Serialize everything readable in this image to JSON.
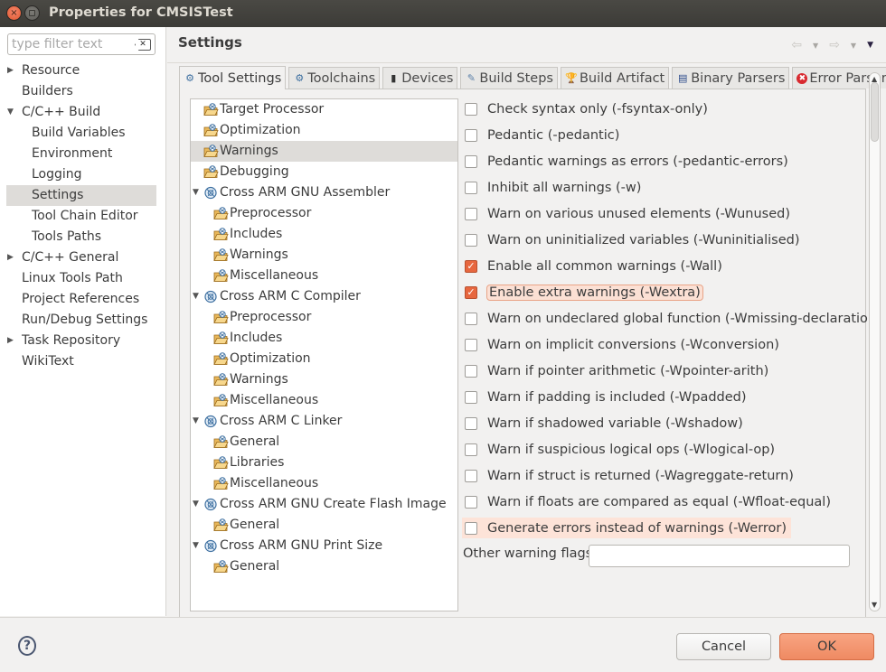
{
  "window": {
    "title": "Properties for CMSISTest"
  },
  "sidebar": {
    "filter_placeholder": "type filter text",
    "items": [
      {
        "label": "Resource",
        "level": 0,
        "twisty": "collapsed",
        "selected": false
      },
      {
        "label": "Builders",
        "level": 0,
        "twisty": "none",
        "selected": false
      },
      {
        "label": "C/C++ Build",
        "level": 0,
        "twisty": "expanded",
        "selected": false
      },
      {
        "label": "Build Variables",
        "level": 1,
        "twisty": "none",
        "selected": false
      },
      {
        "label": "Environment",
        "level": 1,
        "twisty": "none",
        "selected": false
      },
      {
        "label": "Logging",
        "level": 1,
        "twisty": "none",
        "selected": false
      },
      {
        "label": "Settings",
        "level": 1,
        "twisty": "none",
        "selected": true
      },
      {
        "label": "Tool Chain Editor",
        "level": 1,
        "twisty": "none",
        "selected": false
      },
      {
        "label": "Tools Paths",
        "level": 1,
        "twisty": "none",
        "selected": false
      },
      {
        "label": "C/C++ General",
        "level": 0,
        "twisty": "collapsed",
        "selected": false
      },
      {
        "label": "Linux Tools Path",
        "level": 0,
        "twisty": "none",
        "selected": false
      },
      {
        "label": "Project References",
        "level": 0,
        "twisty": "none",
        "selected": false
      },
      {
        "label": "Run/Debug Settings",
        "level": 0,
        "twisty": "none",
        "selected": false
      },
      {
        "label": "Task Repository",
        "level": 0,
        "twisty": "collapsed",
        "selected": false
      },
      {
        "label": "WikiText",
        "level": 0,
        "twisty": "none",
        "selected": false
      }
    ]
  },
  "page": {
    "title": "Settings",
    "nav_icons": [
      "back-arrow-icon",
      "dropdown-icon",
      "forward-arrow-icon",
      "dropdown-icon",
      "view-menu-icon"
    ]
  },
  "tabs": [
    {
      "label": "Tool Settings",
      "icon": "tool-settings-icon",
      "active": true
    },
    {
      "label": "Toolchains",
      "icon": "toolchains-icon",
      "active": false
    },
    {
      "label": "Devices",
      "icon": "devices-chip-icon",
      "active": false
    },
    {
      "label": "Build Steps",
      "icon": "build-steps-icon",
      "active": false
    },
    {
      "label": "Build Artifact",
      "icon": "build-artifact-trophy-icon",
      "active": false
    },
    {
      "label": "Binary Parsers",
      "icon": "binary-parsers-icon",
      "active": false
    },
    {
      "label": "Error Parsers",
      "icon": "error-parsers-icon",
      "active": false
    }
  ],
  "tool_tree": [
    {
      "label": "Target Processor",
      "level": 0,
      "type": "page",
      "twisty": "none",
      "selected": false
    },
    {
      "label": "Optimization",
      "level": 0,
      "type": "page",
      "twisty": "none",
      "selected": false
    },
    {
      "label": "Warnings",
      "level": 0,
      "type": "page",
      "twisty": "none",
      "selected": true
    },
    {
      "label": "Debugging",
      "level": 0,
      "type": "page",
      "twisty": "none",
      "selected": false
    },
    {
      "label": "Cross ARM GNU Assembler",
      "level": 0,
      "type": "tool",
      "twisty": "expanded",
      "selected": false
    },
    {
      "label": "Preprocessor",
      "level": 1,
      "type": "page",
      "twisty": "none",
      "selected": false
    },
    {
      "label": "Includes",
      "level": 1,
      "type": "page",
      "twisty": "none",
      "selected": false
    },
    {
      "label": "Warnings",
      "level": 1,
      "type": "page",
      "twisty": "none",
      "selected": false
    },
    {
      "label": "Miscellaneous",
      "level": 1,
      "type": "page",
      "twisty": "none",
      "selected": false
    },
    {
      "label": "Cross ARM C Compiler",
      "level": 0,
      "type": "tool",
      "twisty": "expanded",
      "selected": false
    },
    {
      "label": "Preprocessor",
      "level": 1,
      "type": "page",
      "twisty": "none",
      "selected": false
    },
    {
      "label": "Includes",
      "level": 1,
      "type": "page",
      "twisty": "none",
      "selected": false
    },
    {
      "label": "Optimization",
      "level": 1,
      "type": "page",
      "twisty": "none",
      "selected": false
    },
    {
      "label": "Warnings",
      "level": 1,
      "type": "page",
      "twisty": "none",
      "selected": false
    },
    {
      "label": "Miscellaneous",
      "level": 1,
      "type": "page",
      "twisty": "none",
      "selected": false
    },
    {
      "label": "Cross ARM C Linker",
      "level": 0,
      "type": "tool",
      "twisty": "expanded",
      "selected": false
    },
    {
      "label": "General",
      "level": 1,
      "type": "page",
      "twisty": "none",
      "selected": false
    },
    {
      "label": "Libraries",
      "level": 1,
      "type": "page",
      "twisty": "none",
      "selected": false
    },
    {
      "label": "Miscellaneous",
      "level": 1,
      "type": "page",
      "twisty": "none",
      "selected": false
    },
    {
      "label": "Cross ARM GNU Create Flash Image",
      "level": 0,
      "type": "tool",
      "twisty": "expanded",
      "selected": false
    },
    {
      "label": "General",
      "level": 1,
      "type": "page",
      "twisty": "none",
      "selected": false
    },
    {
      "label": "Cross ARM GNU Print Size",
      "level": 0,
      "type": "tool",
      "twisty": "expanded",
      "selected": false
    },
    {
      "label": "General",
      "level": 1,
      "type": "page",
      "twisty": "none",
      "selected": false
    }
  ],
  "warning_options": [
    {
      "label": "Check syntax only (-fsyntax-only)",
      "checked": false
    },
    {
      "label": "Pedantic (-pedantic)",
      "checked": false
    },
    {
      "label": "Pedantic warnings as errors (-pedantic-errors)",
      "checked": false
    },
    {
      "label": "Inhibit all warnings (-w)",
      "checked": false
    },
    {
      "label": "Warn on various unused elements (-Wunused)",
      "checked": false
    },
    {
      "label": "Warn on uninitialized variables (-Wuninitialised)",
      "checked": false
    },
    {
      "label": "Enable all common warnings (-Wall)",
      "checked": true
    },
    {
      "label": "Enable extra warnings (-Wextra)",
      "checked": true,
      "focused": true
    },
    {
      "label": "Warn on undeclared global function (-Wmissing-declaration)",
      "checked": false
    },
    {
      "label": "Warn on implicit conversions (-Wconversion)",
      "checked": false
    },
    {
      "label": "Warn if pointer arithmetic (-Wpointer-arith)",
      "checked": false
    },
    {
      "label": "Warn if padding is included (-Wpadded)",
      "checked": false
    },
    {
      "label": "Warn if shadowed variable (-Wshadow)",
      "checked": false
    },
    {
      "label": "Warn if suspicious logical ops (-Wlogical-op)",
      "checked": false
    },
    {
      "label": "Warn if struct is returned (-Wagreggate-return)",
      "checked": false
    },
    {
      "label": "Warn if floats are compared as equal (-Wfloat-equal)",
      "checked": false
    },
    {
      "label": "Generate errors instead of warnings (-Werror)",
      "checked": false,
      "hovered": true
    }
  ],
  "other_flags": {
    "label": "Other warning flags",
    "value": ""
  },
  "footer": {
    "help_label": "?",
    "cancel_label": "Cancel",
    "ok_label": "OK"
  },
  "colors": {
    "accent": "#e7673f",
    "ok_button": "#ef8a62",
    "titlebar": "#3c3b37",
    "highlight_row": "#fde3d8"
  }
}
